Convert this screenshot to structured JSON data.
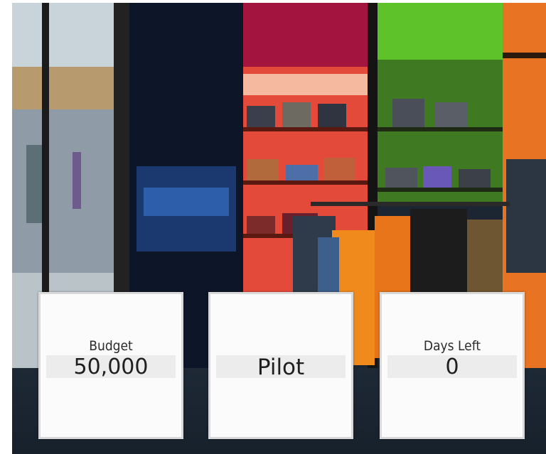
{
  "stats": {
    "budget": {
      "label": "Budget",
      "value": "50,000"
    },
    "mode": {
      "value": "Pilot"
    },
    "days_left": {
      "label": "Days Left",
      "value": "0"
    }
  }
}
